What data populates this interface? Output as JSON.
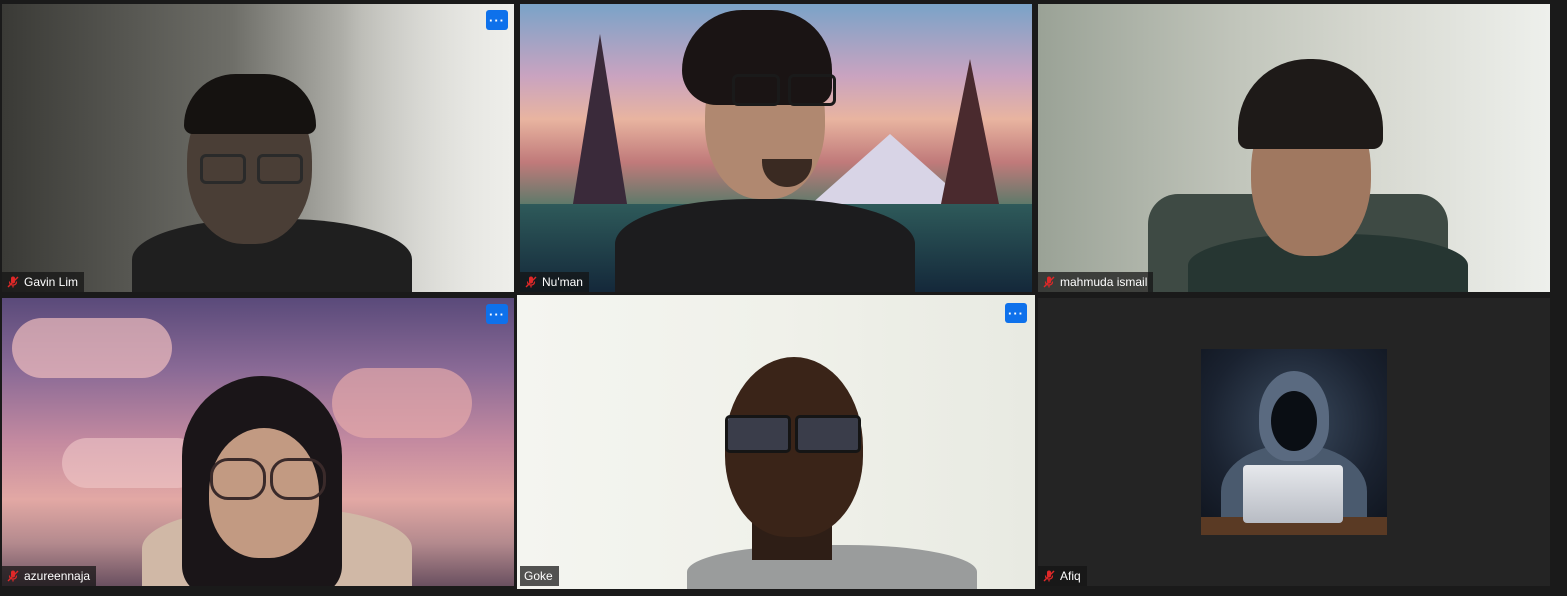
{
  "meeting": {
    "participants": [
      {
        "id": "p1",
        "name": "Gavin Lim",
        "muted": true,
        "show_more": true
      },
      {
        "id": "p2",
        "name": "Nu'man",
        "muted": true,
        "show_more": false
      },
      {
        "id": "p3",
        "name": "mahmuda ismail",
        "muted": true,
        "show_more": false
      },
      {
        "id": "p4",
        "name": "azureennaja",
        "muted": true,
        "show_more": true
      },
      {
        "id": "p5",
        "name": "Goke",
        "muted": false,
        "show_more": true,
        "active_speaker": true
      },
      {
        "id": "p6",
        "name": "Afiq",
        "muted": true,
        "show_more": false,
        "video_off": true,
        "avatar": "hooded-hacker-avatar"
      }
    ],
    "more_label": "···"
  },
  "colors": {
    "accent": "#0e71eb",
    "active_speaker_border": "#d6e65a",
    "muted_icon": "#e02828",
    "background": "#1a1a1a"
  }
}
